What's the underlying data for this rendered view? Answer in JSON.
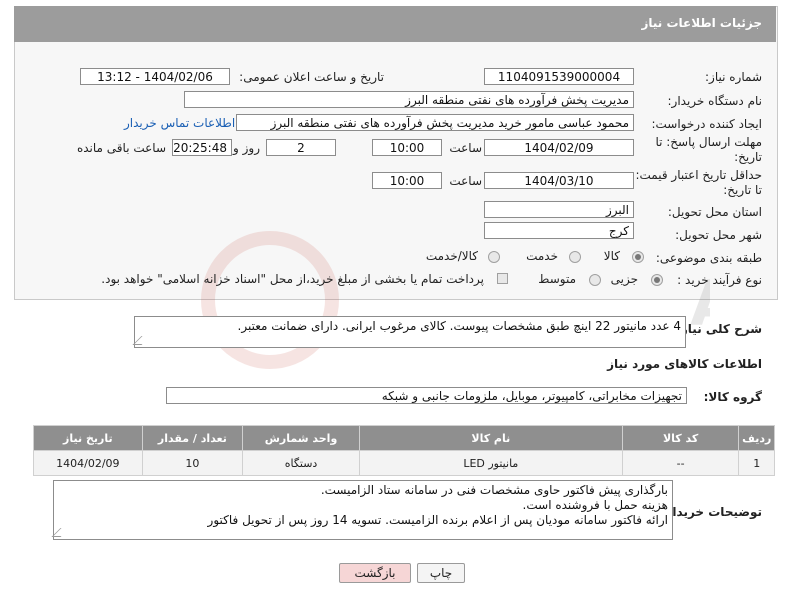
{
  "header": {
    "title": "جزئیات اطلاعات نیاز"
  },
  "fields": {
    "need_number_label": "شماره نیاز:",
    "need_number": "1104091539000004",
    "announce_label": "تاریخ و ساعت اعلان عمومی:",
    "announce_value": "1404/02/06 - 13:12",
    "buyer_org_label": "نام دستگاه خریدار:",
    "buyer_org": "مدیریت پخش فرآورده های نفتی منطقه البرز",
    "creator_label": "ایجاد کننده درخواست:",
    "creator": "محمود عباسی مامور خرید  مدیریت پخش فرآورده های نفتی منطقه البرز",
    "contact_link": "اطلاعات تماس خریدار",
    "deadline_label_1": "مهلت ارسال پاسخ: تا",
    "deadline_label_2": "تاریخ:",
    "deadline_date": "1404/02/09",
    "time_label": "ساعت",
    "deadline_time": "10:00",
    "days_value": "2",
    "days_label": "روز و",
    "remaining_time": "20:25:48",
    "remaining_label": "ساعت باقی مانده",
    "validity_label_1": "حداقل تاریخ اعتبار قیمت:",
    "validity_label_2": "تا تاریخ:",
    "validity_date": "1404/03/10",
    "validity_time": "10:00",
    "province_label": "استان محل تحویل:",
    "province": "البرز",
    "city_label": "شهر محل تحویل:",
    "city": "کرج",
    "category_label": "طبقه بندی موضوعی:",
    "category_options": [
      "کالا",
      "خدمت",
      "کالا/خدمت"
    ],
    "process_label": "نوع فرآیند خرید :",
    "process_options": [
      "جزیی",
      "متوسط"
    ],
    "treasury_note": "پرداخت تمام یا بخشی از مبلغ خرید،از محل \"اسناد خزانه اسلامی\" خواهد بود."
  },
  "description": {
    "label": "شرح کلی نیاز:",
    "text": "4 عدد مانیتور 22 اینچ طبق مشخصات پیوست. کالای مرغوب ایرانی. دارای ضمانت معتبر."
  },
  "goods": {
    "section_title": "اطلاعات کالاهای مورد نیاز",
    "group_label": "گروه کالا:",
    "group_value": "تجهیزات مخابراتی، کامپیوتر، موبایل، ملزومات جانبی و شبکه"
  },
  "table": {
    "headers": [
      "ردیف",
      "کد کالا",
      "نام کالا",
      "واحد شمارش",
      "تعداد / مقدار",
      "تاریخ نیاز"
    ],
    "rows": [
      [
        "1",
        "--",
        "مانیتور LED",
        "دستگاه",
        "10",
        "1404/02/09"
      ]
    ]
  },
  "buyer_notes": {
    "label": "توضیحات خریدار:",
    "lines": [
      "بارگذاری پیش فاکتور حاوی مشخصات فنی در سامانه ستاد الزامیست.",
      "هزینه حمل با فروشنده است.",
      "ارائه فاکتور سامانه مودیان پس از اعلام برنده الزامیست. تسویه 14 روز پس از تحویل فاکتور"
    ]
  },
  "buttons": {
    "print": "چاپ",
    "back": "بازگشت"
  },
  "watermark_text": "AriaTender.neT",
  "colors": {
    "header_bg": "#9c9c9c",
    "link": "#1a5fb4",
    "back_btn_bg": "#f6d6d6"
  }
}
